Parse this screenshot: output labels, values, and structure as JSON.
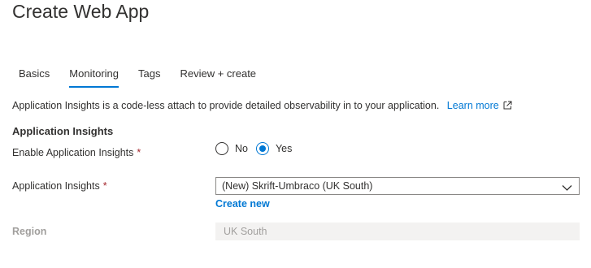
{
  "page": {
    "title": "Create Web App"
  },
  "tabs": [
    {
      "label": "Basics"
    },
    {
      "label": "Monitoring"
    },
    {
      "label": "Tags"
    },
    {
      "label": "Review + create"
    }
  ],
  "active_tab": "Monitoring",
  "intro": {
    "text": "Application Insights is a code-less attach to provide detailed observability in to your application.",
    "link_label": "Learn more"
  },
  "section": {
    "title": "Application Insights"
  },
  "enable_field": {
    "label": "Enable Application Insights",
    "required_mark": "*",
    "options": [
      {
        "label": "No",
        "checked": false
      },
      {
        "label": "Yes",
        "checked": true
      }
    ]
  },
  "insights_field": {
    "label": "Application Insights",
    "required_mark": "*",
    "selected_value": "(New) Skrift-Umbraco (UK South)",
    "create_new_label": "Create new"
  },
  "region_field": {
    "label": "Region",
    "value": "UK South",
    "disabled": true
  },
  "colors": {
    "accent": "#0078d4",
    "required": "#a4262c",
    "disabled_text": "#a19f9d",
    "disabled_bg": "#f3f2f1"
  },
  "icons": {
    "external_link": "external-link-icon",
    "dropdown": "chevron-down-icon"
  }
}
